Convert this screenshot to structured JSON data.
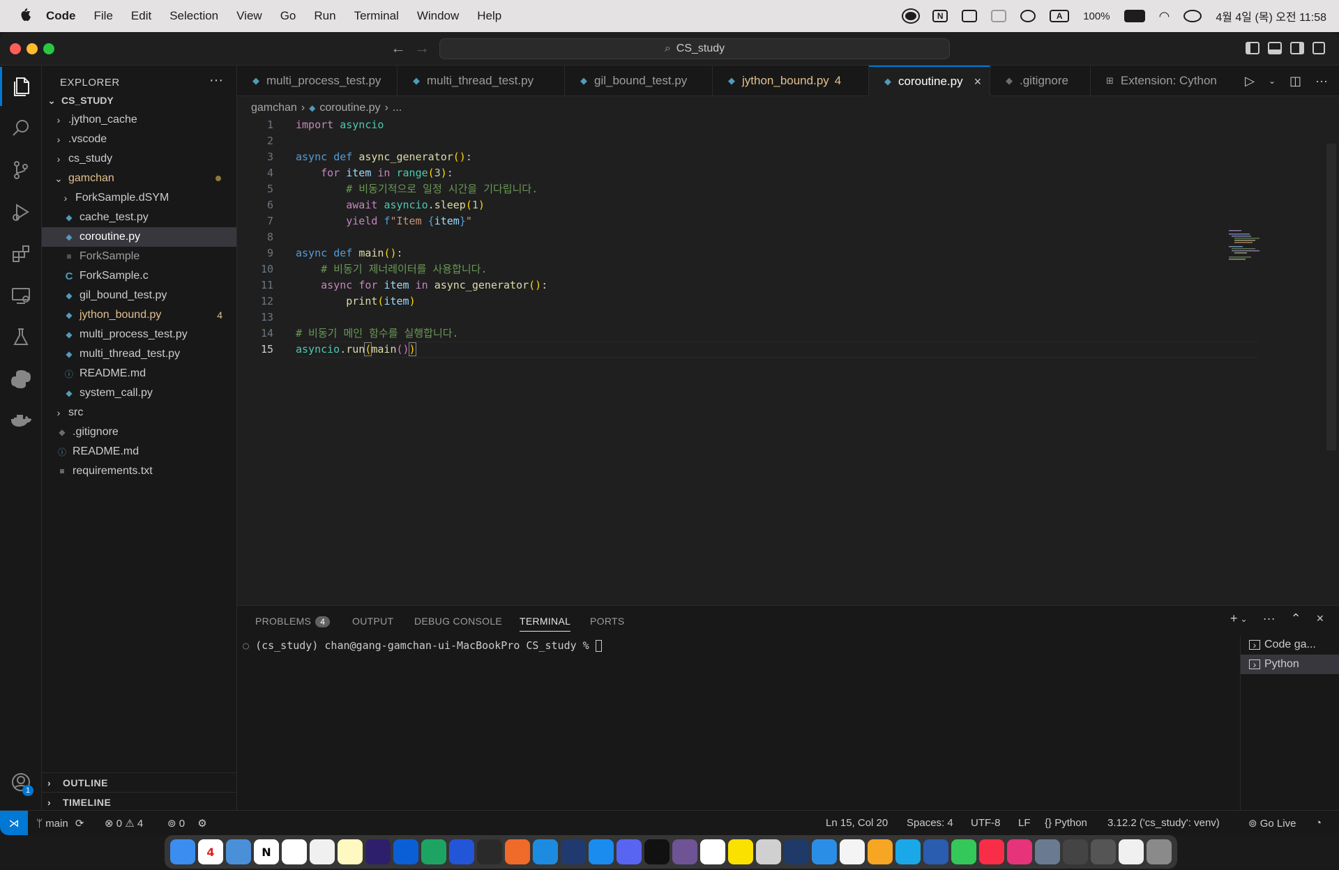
{
  "menubar": {
    "app": "Code",
    "items": [
      "File",
      "Edit",
      "Selection",
      "View",
      "Go",
      "Run",
      "Terminal",
      "Window",
      "Help"
    ],
    "battery": "100%",
    "datetime": "4월 4일 (목) 오전 11:58"
  },
  "titlebar": {
    "search": "CS_study"
  },
  "explorer": {
    "header": "EXPLORER",
    "root": "CS_STUDY",
    "items": [
      {
        "label": ".jython_cache"
      },
      {
        "label": ".vscode"
      },
      {
        "label": "cs_study"
      },
      {
        "label": "gamchan"
      },
      {
        "label": "ForkSample.dSYM"
      },
      {
        "label": "cache_test.py"
      },
      {
        "label": "coroutine.py"
      },
      {
        "label": "ForkSample"
      },
      {
        "label": "ForkSample.c",
        "icon": "C"
      },
      {
        "label": "gil_bound_test.py"
      },
      {
        "label": "jython_bound.py",
        "badge": "4"
      },
      {
        "label": "multi_process_test.py"
      },
      {
        "label": "multi_thread_test.py"
      },
      {
        "label": "README.md"
      },
      {
        "label": "system_call.py"
      },
      {
        "label": "src"
      },
      {
        "label": ".gitignore"
      },
      {
        "label": "README.md"
      },
      {
        "label": "requirements.txt"
      }
    ],
    "outline": "OUTLINE",
    "timeline": "TIMELINE",
    "accounts_badge": "1"
  },
  "tabs": [
    {
      "label": "multi_process_test.py"
    },
    {
      "label": "multi_thread_test.py"
    },
    {
      "label": "gil_bound_test.py"
    },
    {
      "label": "jython_bound.py",
      "count": "4"
    },
    {
      "label": "coroutine.py"
    },
    {
      "label": ".gitignore"
    },
    {
      "label": "Extension: Cython"
    }
  ],
  "breadcrumb": {
    "folder": "gamchan",
    "file": "coroutine.py",
    "more": "..."
  },
  "editor": {
    "line_numbers": [
      "1",
      "2",
      "3",
      "4",
      "5",
      "6",
      "7",
      "8",
      "9",
      "10",
      "11",
      "12",
      "13",
      "14",
      "15"
    ],
    "current_line": 15
  },
  "panel": {
    "tabs": [
      "PROBLEMS",
      "OUTPUT",
      "DEBUG CONSOLE",
      "TERMINAL",
      "PORTS"
    ],
    "problems_count": "4",
    "terminal_prompt": "(cs_study) chan@gang-gamchan-ui-MacBookPro CS_study % ",
    "terminals": [
      "Code ga...",
      "Python"
    ]
  },
  "status": {
    "branch": "main",
    "errors": "0",
    "warnings": "4",
    "ports": "0",
    "position": "Ln 15, Col 20",
    "spaces": "Spaces: 4",
    "encoding": "UTF-8",
    "eol": "LF",
    "language": "Python",
    "interpreter": "3.12.2 ('cs_study': venv)",
    "golive": "Go Live"
  },
  "dock": {
    "calendar_day": "4"
  },
  "colors": {
    "accent": "#0078d4",
    "keyword": "#569cd6",
    "control": "#c586c0",
    "function": "#dcdcaa",
    "comment": "#6a9955"
  }
}
